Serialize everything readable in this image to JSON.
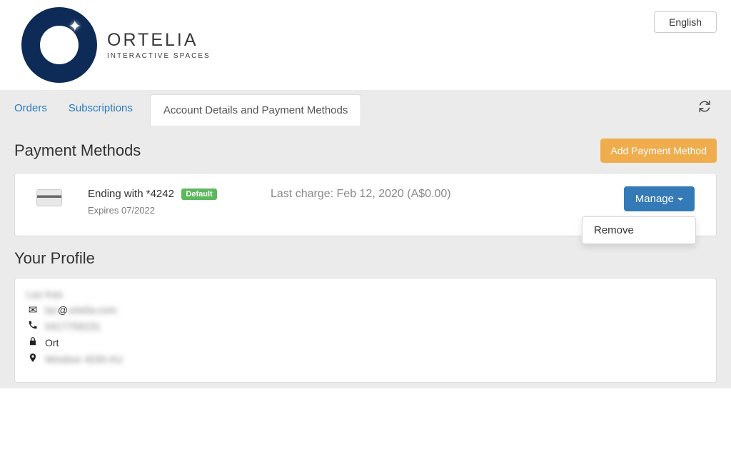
{
  "header": {
    "brand_name": "ORTELIA",
    "brand_tagline": "INTERACTIVE SPACES",
    "language_label": "English"
  },
  "tabs": {
    "orders": "Orders",
    "subscriptions": "Subscriptions",
    "account_details": "Account Details and Payment Methods"
  },
  "payment_methods": {
    "title": "Payment Methods",
    "add_button": "Add Payment Method",
    "card": {
      "ending_prefix": "Ending with *",
      "last4": "4242",
      "default_badge": "Default",
      "expires_label": "Expires",
      "expires_value": "07/2022",
      "last_charge_label": "Last charge:",
      "last_charge_date": "Feb 12, 2020",
      "last_charge_amount": "(A$0.00)",
      "manage_label": "Manage",
      "dropdown": {
        "remove": "Remove"
      }
    }
  },
  "profile": {
    "title": "Your Profile",
    "name": "Laz Kas",
    "email_visible": "@",
    "email_hidden_left": "laz",
    "email_hidden_right": "ortelia.com",
    "phone": "0417758231",
    "company": "Ort",
    "address": "Windsor 4030 AU"
  }
}
